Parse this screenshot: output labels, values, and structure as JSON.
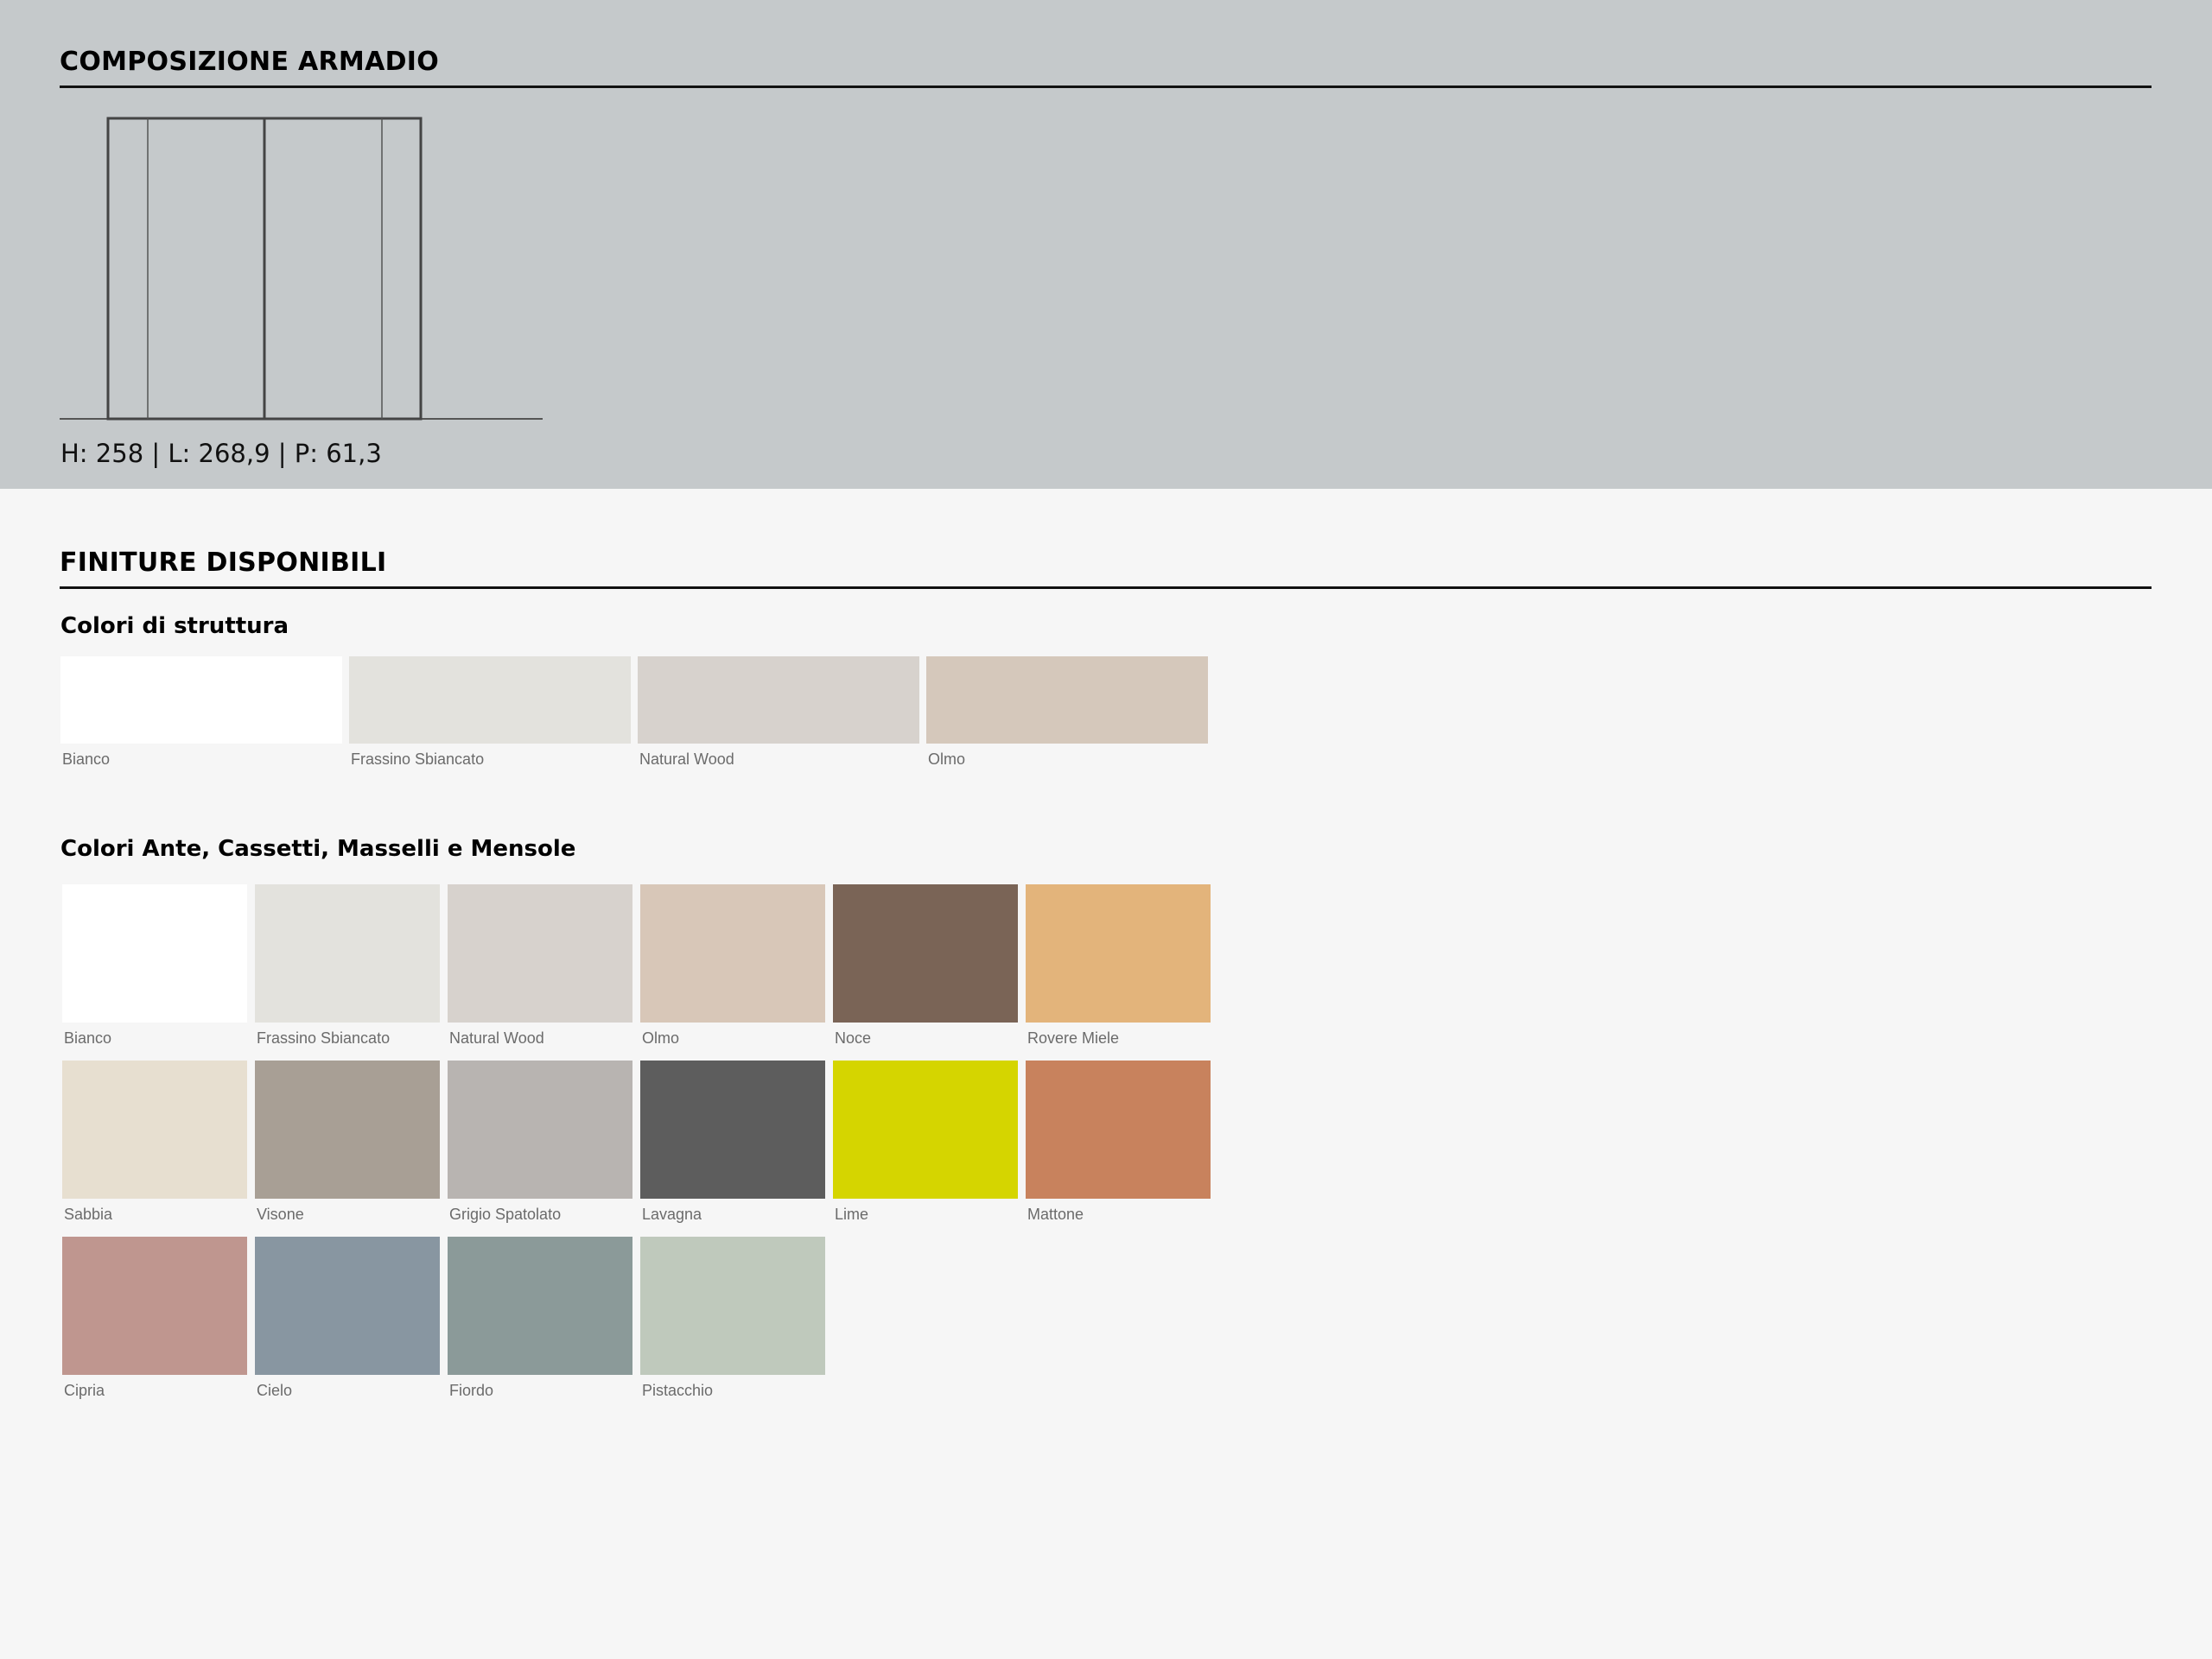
{
  "composition": {
    "title": "COMPOSIZIONE ARMADIO",
    "dimensions": "H: 258 | L: 268,9 | P: 61,3"
  },
  "finishes": {
    "title": "FINITURE DISPONIBILI",
    "structure": {
      "title": "Colori di struttura",
      "items": [
        {
          "label": "Bianco",
          "color": "#ffffff"
        },
        {
          "label": "Frassino Sbiancato",
          "color": "#e3e2dd"
        },
        {
          "label": "Natural Wood",
          "color": "#d7d2cd"
        },
        {
          "label": "Olmo",
          "color": "#d5c8bb"
        }
      ]
    },
    "doors": {
      "title": "Colori Ante, Cassetti, Masselli e Mensole",
      "items": [
        {
          "label": "Bianco",
          "color": "#ffffff"
        },
        {
          "label": "Frassino Sbiancato",
          "color": "#e3e2dd"
        },
        {
          "label": "Natural Wood",
          "color": "#d7d2cd"
        },
        {
          "label": "Olmo",
          "color": "#d8c7b8"
        },
        {
          "label": "Noce",
          "color": "#7a6456"
        },
        {
          "label": "Rovere Miele",
          "color": "#e3b47b"
        },
        {
          "label": "Sabbia",
          "color": "#e7dfd0"
        },
        {
          "label": "Visone",
          "color": "#a89f95"
        },
        {
          "label": "Grigio Spatolato",
          "color": "#b8b4b1"
        },
        {
          "label": "Lavagna",
          "color": "#5d5d5d"
        },
        {
          "label": "Lime",
          "color": "#d5d500"
        },
        {
          "label": "Mattone",
          "color": "#c8825d"
        },
        {
          "label": "Cipria",
          "color": "#bf968f"
        },
        {
          "label": "Cielo",
          "color": "#8896a1"
        },
        {
          "label": "Fiordo",
          "color": "#8b9a99"
        },
        {
          "label": "Pistacchio",
          "color": "#bfc9bc"
        }
      ]
    }
  }
}
